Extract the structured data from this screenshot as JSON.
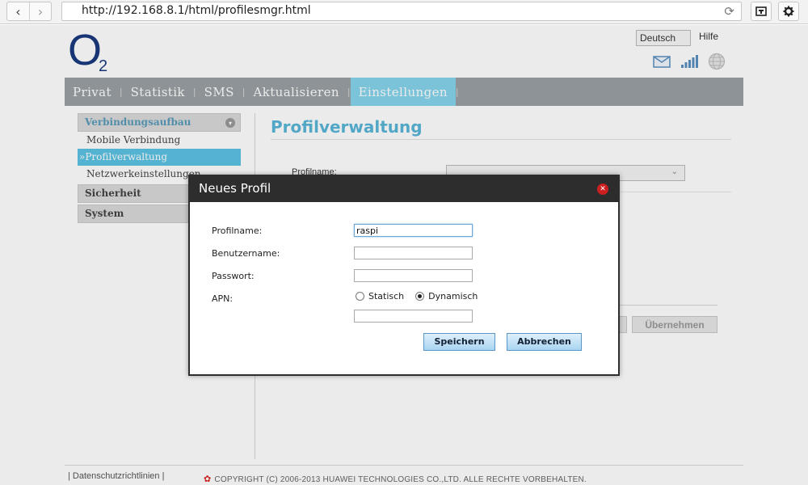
{
  "browser": {
    "url": "http://192.168.8.1/html/profilesmgr.html",
    "back_glyph": "‹",
    "forward_glyph": "›",
    "reload_glyph": "⟳"
  },
  "header": {
    "logo_letter": "O",
    "logo_sub": "2",
    "language": "Deutsch",
    "help": "Hilfe"
  },
  "menu": {
    "items": [
      {
        "label": "Privat",
        "active": false
      },
      {
        "label": "Statistik",
        "active": false
      },
      {
        "label": "SMS",
        "active": false
      },
      {
        "label": "Aktualisieren",
        "active": false
      },
      {
        "label": "Einstellungen",
        "active": true
      }
    ]
  },
  "sidebar": {
    "section1": "Verbindungsaufbau",
    "items": [
      "Mobile Verbindung",
      "»Profilverwaltung",
      "Netzwerkeinstellungen"
    ],
    "section2": "Sicherheit",
    "section3": "System"
  },
  "main": {
    "title": "Profilverwaltung",
    "profile_label": "Profilname:",
    "apply_button": "Übernehmen"
  },
  "footer": {
    "privacy": "| Datenschutzrichtlinien |",
    "copyright": "COPYRIGHT (C) 2006-2013 HUAWEI TECHNOLOGIES CO.,LTD. ALLE RECHTE VORBEHALTEN."
  },
  "dialog": {
    "title": "Neues Profil",
    "close_glyph": "✕",
    "fields": {
      "profile_name_label": "Profilname:",
      "profile_name_value": "raspi",
      "username_label": "Benutzername:",
      "username_value": "",
      "password_label": "Passwort:",
      "password_value": "",
      "apn_label": "APN:",
      "apn_static": "Statisch",
      "apn_dynamic": "Dynamisch",
      "apn_selected": "Dynamisch",
      "apn_value": ""
    },
    "save_button": "Speichern",
    "cancel_button": "Abbrechen"
  },
  "colors": {
    "menu_bg": "#9aa0a3",
    "menu_active": "#86d4ec",
    "title_blue": "#5ab6d8",
    "logo_blue": "#1a3a7e",
    "dialog_header": "#2d2d2d",
    "close_red": "#cc2020"
  },
  "icons": {
    "mail": "mail-icon",
    "signal": "signal-strength-icon",
    "globe": "globe-icon",
    "router": "router-icon",
    "settings": "gear-icon"
  }
}
